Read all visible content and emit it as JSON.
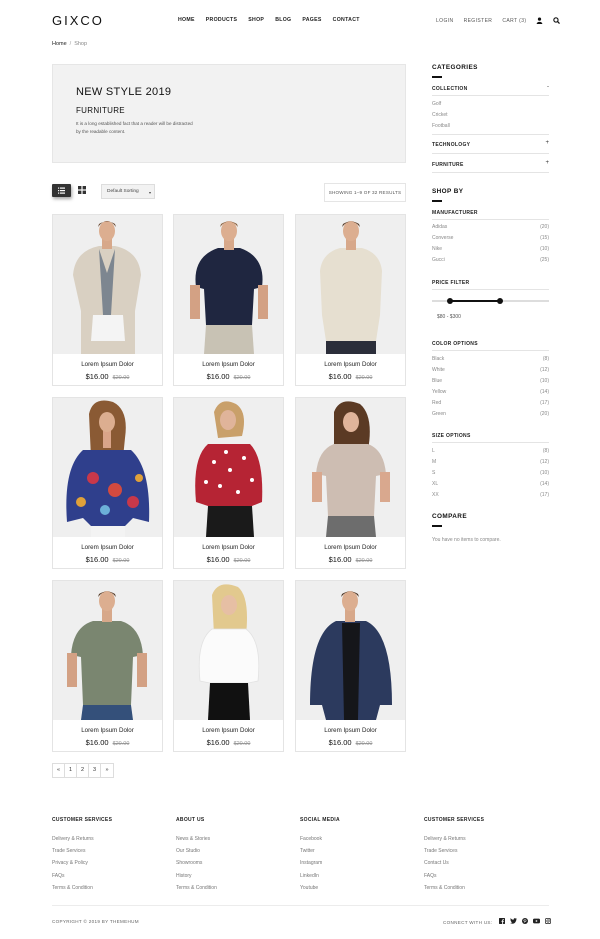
{
  "header": {
    "logo": "GIXCO",
    "nav": [
      "HOME",
      "PRODUCTS",
      "SHOP",
      "BLOG",
      "PAGES",
      "CONTACT"
    ],
    "login": "LOGIN",
    "register": "REGISTER",
    "cart": "CART (3)",
    "icons": [
      "user-icon",
      "search-icon"
    ]
  },
  "breadcrumb": {
    "home": "Home",
    "current": "Shop"
  },
  "hero": {
    "title": "NEW STYLE 2019",
    "subtitle": "FURNITURE",
    "text": "It is a long established fact that a reader will be distracted by the readable content."
  },
  "toolbar": {
    "sort_label": "Default Sorting",
    "results": "SHOWING 1–9 OF 32 RESULTS"
  },
  "products": [
    {
      "name": "Lorem Ipsum Dolor",
      "price": "$16.00",
      "old_price": "$20.00"
    },
    {
      "name": "Lorem Ipsum Dolor",
      "price": "$16.00",
      "old_price": "$20.00"
    },
    {
      "name": "Lorem Ipsum Dolor",
      "price": "$16.00",
      "old_price": "$20.00"
    },
    {
      "name": "Lorem Ipsum Dolor",
      "price": "$16.00",
      "old_price": "$20.00"
    },
    {
      "name": "Lorem Ipsum Dolor",
      "price": "$16.00",
      "old_price": "$20.00"
    },
    {
      "name": "Lorem Ipsum Dolor",
      "price": "$16.00",
      "old_price": "$20.00"
    },
    {
      "name": "Lorem Ipsum Dolor",
      "price": "$16.00",
      "old_price": "$20.00"
    },
    {
      "name": "Lorem Ipsum Dolor",
      "price": "$16.00",
      "old_price": "$20.00"
    },
    {
      "name": "Lorem Ipsum Dolor",
      "price": "$16.00",
      "old_price": "$20.00"
    }
  ],
  "pagination": [
    "«",
    "1",
    "2",
    "3",
    "»"
  ],
  "sidebar": {
    "categories_title": "CATEGORIES",
    "collection": {
      "label": "COLLECTION",
      "toggle": "-",
      "items": [
        "Golf",
        "Cricket",
        "Football"
      ]
    },
    "technology": {
      "label": "TECHNOLOGY",
      "toggle": "+"
    },
    "furniture": {
      "label": "FURNITURE",
      "toggle": "+"
    },
    "shopby_title": "SHOP BY",
    "manufacturer": {
      "label": "MANUFACTURER",
      "items": [
        {
          "name": "Adidas",
          "count": "(20)"
        },
        {
          "name": "Converse",
          "count": "(15)"
        },
        {
          "name": "Nike",
          "count": "(10)"
        },
        {
          "name": "Gucci",
          "count": "(25)"
        }
      ]
    },
    "price_filter": {
      "label": "PRICE FILTER",
      "range": "$80 - $300",
      "low_fraction": 0.15,
      "high_fraction": 0.58
    },
    "color_options": {
      "label": "COLOR OPTIONS",
      "items": [
        {
          "name": "Black",
          "count": "(8)"
        },
        {
          "name": "White",
          "count": "(12)"
        },
        {
          "name": "Blue",
          "count": "(10)"
        },
        {
          "name": "Yellow",
          "count": "(14)"
        },
        {
          "name": "Red",
          "count": "(17)"
        },
        {
          "name": "Green",
          "count": "(20)"
        }
      ]
    },
    "size_options": {
      "label": "SIZE OPTIONS",
      "items": [
        {
          "name": "L",
          "count": "(8)"
        },
        {
          "name": "M",
          "count": "(12)"
        },
        {
          "name": "S",
          "count": "(10)"
        },
        {
          "name": "XL",
          "count": "(14)"
        },
        {
          "name": "XX",
          "count": "(17)"
        }
      ]
    },
    "compare_title": "COMPARE",
    "compare_text": "You have no items to compare."
  },
  "footer": {
    "columns": [
      {
        "title": "CUSTOMER SERVICES",
        "items": [
          "Delivery & Returns",
          "Trade Services",
          "Privacy & Policy",
          "FAQs",
          "Terms & Condition"
        ]
      },
      {
        "title": "ABOUT US",
        "items": [
          "News & Stories",
          "Our Studio",
          "Showrooms",
          "History",
          "Terms & Condition"
        ]
      },
      {
        "title": "SOCIAL MEDIA",
        "items": [
          "Facebook",
          "Twitter",
          "Instagram",
          "LinkedIn",
          "Youtube"
        ]
      },
      {
        "title": "CUSTOMER SERVICES",
        "items": [
          "Delivery & Returns",
          "Trade Services",
          "Contact Us",
          "FAQs",
          "Terms & Condition"
        ]
      }
    ],
    "copyright": "COPYRIGHT © 2019 BY THEMEHUM",
    "connect": "CONNECT WITH US:",
    "social_icons": [
      "facebook-icon",
      "twitter-icon",
      "pinterest-icon",
      "youtube-icon",
      "instagram-icon"
    ]
  },
  "colors": {
    "accent": "#111111",
    "panel": "#f2f2f2",
    "border": "#e4e4e4",
    "muted": "#888888"
  }
}
